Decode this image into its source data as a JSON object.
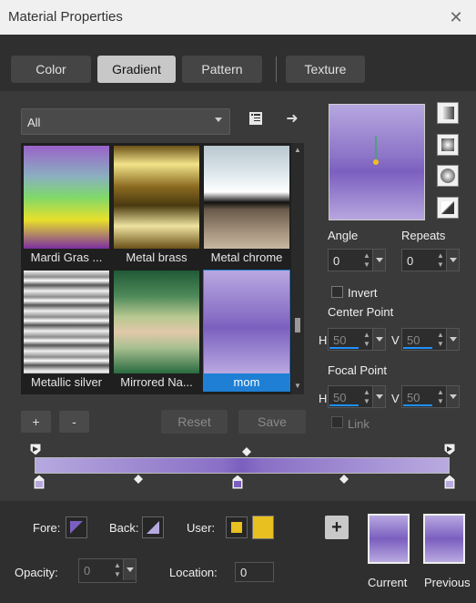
{
  "window": {
    "title": "Material Properties",
    "close": "✕"
  },
  "tabs": [
    "Color",
    "Gradient",
    "Pattern",
    "Texture"
  ],
  "active_tab": "Gradient",
  "category": {
    "value": "All"
  },
  "gradients": [
    {
      "label": "Mardi Gras ..."
    },
    {
      "label": "Metal brass"
    },
    {
      "label": "Metal chrome"
    },
    {
      "label": "Metallic silver"
    },
    {
      "label": "Mirrored Na..."
    },
    {
      "label": "mom"
    }
  ],
  "selected_gradient": "mom",
  "list_buttons": {
    "add": "+",
    "remove": "-",
    "reset": "Reset",
    "save": "Save"
  },
  "angle": {
    "label": "Angle",
    "value": "0"
  },
  "repeats": {
    "label": "Repeats",
    "value": "0"
  },
  "invert": {
    "label": "Invert",
    "checked": false
  },
  "center_point": {
    "label": "Center Point",
    "h_label": "H",
    "h": "50",
    "v_label": "V",
    "v": "50"
  },
  "focal_point": {
    "label": "Focal Point",
    "h_label": "H",
    "h": "50",
    "v_label": "V",
    "v": "50"
  },
  "link": {
    "label": "Link",
    "checked": false
  },
  "bottom": {
    "fore_label": "Fore:",
    "back_label": "Back:",
    "user_label": "User:",
    "opacity_label": "Opacity:",
    "opacity": "0",
    "location_label": "Location:",
    "location": "0",
    "add": "+",
    "current_label": "Current",
    "previous_label": "Previous"
  },
  "colors": {
    "accent": "#1e7fd4",
    "gradient_light": "#b6a9df",
    "gradient_dark": "#7b5fbf",
    "user_color": "#e8c020"
  }
}
